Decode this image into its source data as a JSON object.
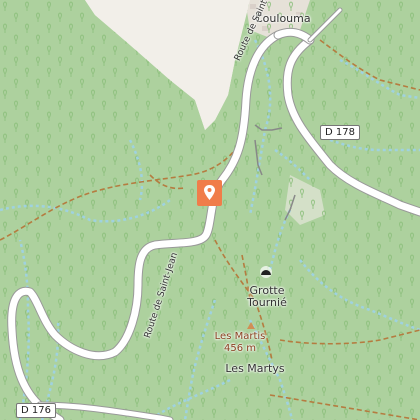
{
  "place_labels": {
    "village": "Coulouma",
    "hamlet": "Les Martys"
  },
  "road_labels": {
    "route_north": "Route de Saint-Jean",
    "route_south": "Route de Saint-Jean"
  },
  "road_shields": {
    "east": "D 178",
    "southwest": "D 176"
  },
  "poi": {
    "cave_name_line1": "Grotte",
    "cave_name_line2": "Tournié",
    "peak_name": "Les Martis",
    "peak_elevation": "456 m"
  },
  "marker": {
    "icon": "location-pin-icon",
    "color": "#f07d4a"
  },
  "colors": {
    "forest": "#add19e",
    "open_land": "#f2efe9",
    "road": "#ffffff",
    "track": "#b57c40",
    "footpath": "#a9d8e6"
  }
}
